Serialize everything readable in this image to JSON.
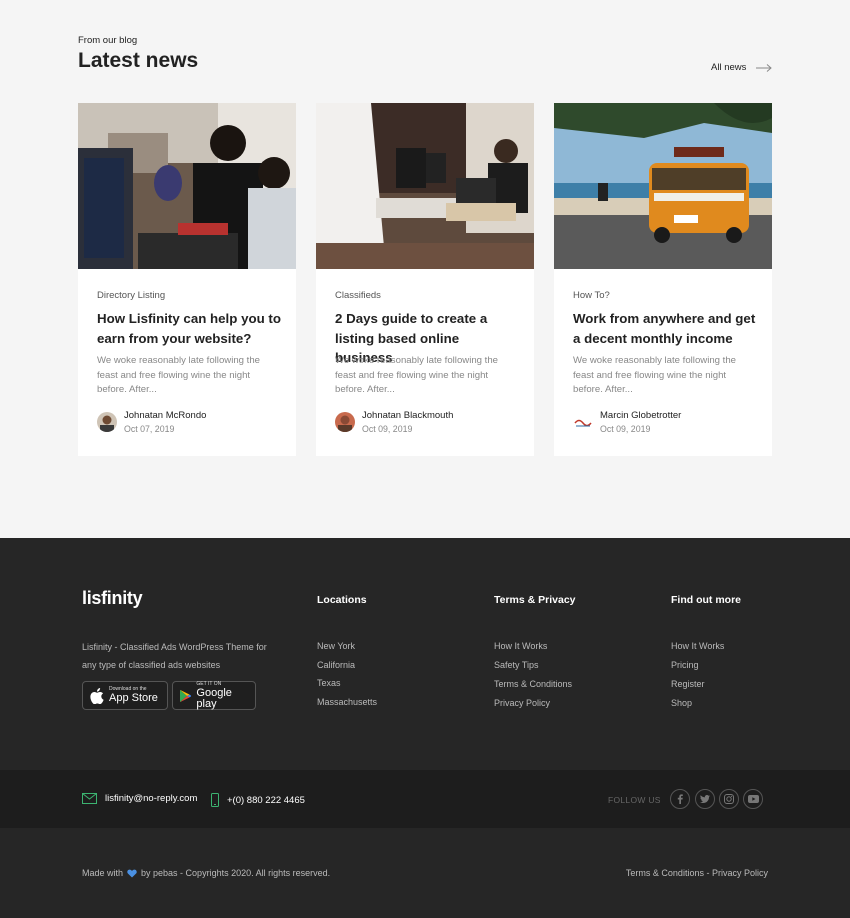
{
  "blog": {
    "eyebrow": "From our blog",
    "heading": "Latest news",
    "all_news": "All news"
  },
  "posts": [
    {
      "category": "Directory Listing",
      "title": "How Lisfinity can help you to earn from your website?",
      "excerpt": "We woke reasonably late following the feast and free flowing wine the night before. After...",
      "author": "Johnatan McRondo",
      "date": "Oct 07, 2019"
    },
    {
      "category": "Classifieds",
      "title": "2 Days guide to create a listing based online business",
      "excerpt": "We woke reasonably late following the feast and free flowing wine the night before. After...",
      "author": "Johnatan Blackmouth",
      "date": "Oct 09, 2019"
    },
    {
      "category": "How To?",
      "title": "Work from anywhere and get a decent monthly income",
      "excerpt": "We woke reasonably late following the feast and free flowing wine the night before. After...",
      "author": "Marcin Globetrotter",
      "date": "Oct 09, 2019"
    }
  ],
  "footer": {
    "logo": "lisfinity",
    "tagline": "Lisfinity - Classified Ads WordPress Theme for any type of classified ads websites",
    "app_store": {
      "small": "Download on the",
      "big": "App Store"
    },
    "google_play": {
      "small": "GET IT ON",
      "big": "Google play"
    },
    "columns": [
      {
        "title": "Locations",
        "items": [
          "New York",
          "California",
          "Texas",
          "Massachusetts"
        ]
      },
      {
        "title": "Terms & Privacy",
        "items": [
          "How It Works",
          "Safety Tips",
          "Terms & Conditions",
          "Privacy Policy"
        ]
      },
      {
        "title": "Find out more",
        "items": [
          "How It Works",
          "Pricing",
          "Register",
          "Shop"
        ]
      }
    ],
    "email": "lisfinity@no-reply.com",
    "phone": "+(0) 880 222 4465",
    "follow_us": "FOLLOW US",
    "copyright_prefix": "Made with",
    "copyright_suffix": "by pebas - Copyrights 2020. All rights reserved.",
    "legal_terms": "Terms & Conditions",
    "legal_sep": "-",
    "legal_privacy": "Privacy Policy"
  },
  "colors": {
    "accent_green": "#3cb371",
    "heart_blue": "#4a90e2",
    "footer_bg": "#262626",
    "footer_mid_bg": "#1d1d1d"
  }
}
